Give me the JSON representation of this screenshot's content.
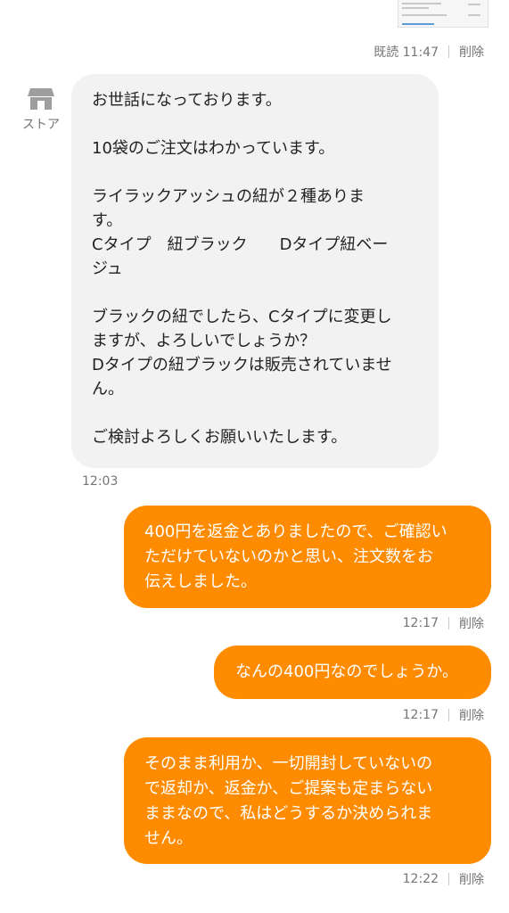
{
  "header_meta": {
    "read_label": "既読 11:47",
    "delete_label": "削除"
  },
  "store": {
    "label": "ストア"
  },
  "incoming": {
    "text": "お世話になっております。\n\n10袋のご注文はわかっています。\n\nライラックアッシュの紐が２種ありま\nす。\nCタイプ　紐ブラック　　Dタイプ紐ベー\nジュ\n\nブラックの紐でしたら、Cタイプに変更し\nますが、よろしいでしょうか？\nDタイプの紐ブラックは販売されていませ\nん。\n\nご検討よろしくお願いいたします。",
    "time": "12:03"
  },
  "outgoing": [
    {
      "text": "400円を返金とありましたので、ご確認い\nただけていないのかと思い、注文数をお\n伝えしました。",
      "time": "12:17",
      "delete_label": "削除"
    },
    {
      "text": "なんの400円なのでしょうか。",
      "time": "12:17",
      "delete_label": "削除"
    },
    {
      "text": "そのまま利用か、一切開封していないの\nで返却か、返金か、ご提案も定まらない\nままなので、私はどうするか決められま\nせん。",
      "time": "12:22",
      "delete_label": "削除"
    }
  ],
  "colors": {
    "outgoing_bubble": "#ff8c00",
    "incoming_bubble": "#f2f2f2"
  },
  "icons": {
    "store": "store-icon"
  }
}
